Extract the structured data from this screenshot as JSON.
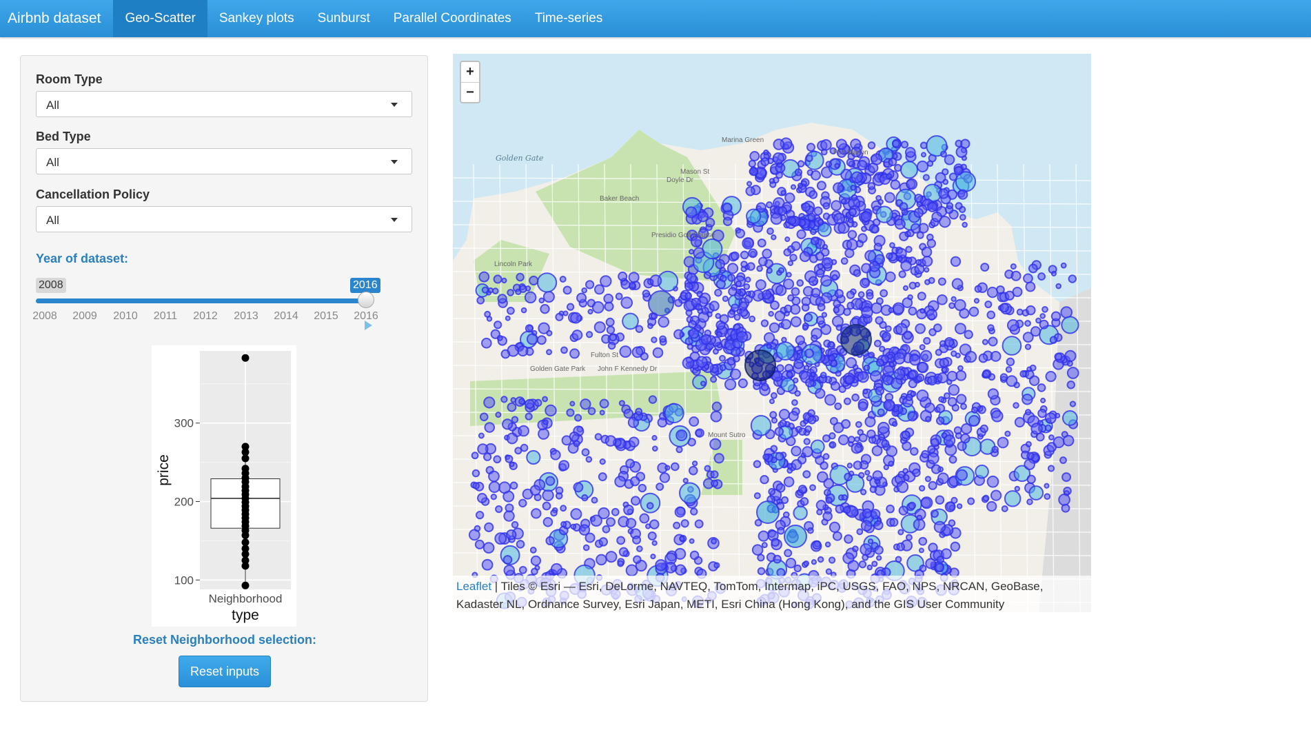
{
  "navbar": {
    "brand": "Airbnb dataset",
    "tabs": [
      {
        "label": "Geo-Scatter",
        "active": true
      },
      {
        "label": "Sankey plots",
        "active": false
      },
      {
        "label": "Sunburst",
        "active": false
      },
      {
        "label": "Parallel Coordinates",
        "active": false
      },
      {
        "label": "Time-series",
        "active": false
      }
    ]
  },
  "sidebar": {
    "room_type": {
      "label": "Room Type",
      "value": "All"
    },
    "bed_type": {
      "label": "Bed Type",
      "value": "All"
    },
    "cancellation": {
      "label": "Cancellation Policy",
      "value": "All"
    },
    "year": {
      "label": "Year of dataset:",
      "min_value": "2008",
      "max_value": "2016",
      "ticks": [
        "2008",
        "2009",
        "2010",
        "2011",
        "2012",
        "2013",
        "2014",
        "2015",
        "2016"
      ]
    },
    "reset_label": "Reset Neighborhood selection:",
    "reset_button": "Reset inputs"
  },
  "chart_data": {
    "type": "box",
    "xlabel": "type",
    "ylabel": "price",
    "categories": [
      "Neighborhood"
    ],
    "y_ticks": [
      100,
      200,
      300
    ],
    "ylim": [
      88,
      392
    ],
    "box": {
      "q1": 166,
      "median": 204,
      "q3": 229,
      "whisker_low": 93,
      "whisker_high": 270
    },
    "points": [
      383,
      270,
      263,
      255,
      242,
      236,
      230,
      225,
      219,
      214,
      209,
      204,
      199,
      194,
      189,
      184,
      179,
      174,
      169,
      163,
      157,
      148,
      140,
      133,
      125,
      118,
      93
    ],
    "grid": true
  },
  "map": {
    "zoom_in": "+",
    "zoom_out": "−",
    "attribution_link": "Leaflet",
    "attribution_text": " | Tiles © Esri — Esri, DeLorme, NAVTEQ, TomTom, Intermap, iPC, USGS, FAO, NPS, NRCAN, GeoBase, Kadaster NL, Ordnance Survey, Esri Japan, METI, Esri China (Hong Kong), and the GIS User Community",
    "labels": {
      "golden_gate": "Golden Gate",
      "marina": "Marina Green",
      "fort_mason": "Fort Mason",
      "presidio": "Presidio Golf Course",
      "golden_gate_park": "Golden Gate Park",
      "lincoln": "Lincoln Park",
      "baker": "Baker Beach",
      "doyle": "Doyle Dr",
      "mason": "Mason St",
      "fulton": "Fulton St",
      "kennedy": "John F Kennedy Dr",
      "sutro": "Mount Sutro"
    },
    "colors": {
      "water": "#cfe8f4",
      "land": "#f2efe9",
      "park": "#c9e3b0",
      "marker": "#3b3bf0",
      "marker_big": "#4fb8e0"
    }
  }
}
